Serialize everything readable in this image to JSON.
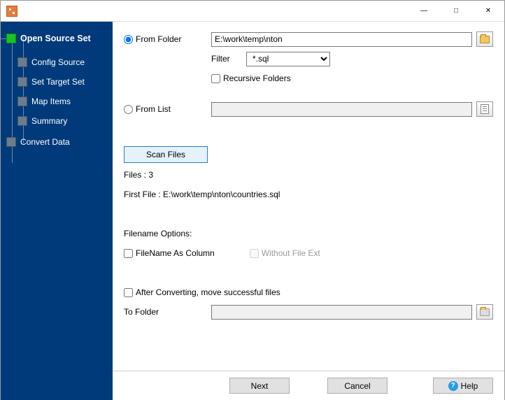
{
  "sidebar": {
    "items": [
      {
        "label": "Open Source Set",
        "active": true,
        "depth": 0
      },
      {
        "label": "Config Source",
        "active": false,
        "depth": 1
      },
      {
        "label": "Set Target Set",
        "active": false,
        "depth": 1
      },
      {
        "label": "Map Items",
        "active": false,
        "depth": 1
      },
      {
        "label": "Summary",
        "active": false,
        "depth": 1
      },
      {
        "label": "Convert Data",
        "active": false,
        "depth": 0
      }
    ]
  },
  "source": {
    "from_folder_label": "From Folder",
    "folder_path": "E:\\work\\temp\\nton",
    "filter_label": "Filter",
    "filter_value": "*.sql",
    "recursive_label": "Recursive Folders",
    "from_list_label": "From List",
    "from_list_value": ""
  },
  "scan": {
    "button_label": "Scan Files",
    "files_label": "Files : 3",
    "first_file_label": "First File : E:\\work\\temp\\nton\\countries.sql"
  },
  "filename_options": {
    "heading": "Filename Options:",
    "as_column_label": "FileName As Column",
    "without_ext_label": "Without File Ext"
  },
  "after": {
    "move_label": "After Converting, move successful files",
    "to_folder_label": "To Folder",
    "to_folder_value": ""
  },
  "footer": {
    "next": "Next",
    "cancel": "Cancel",
    "help": "Help"
  }
}
